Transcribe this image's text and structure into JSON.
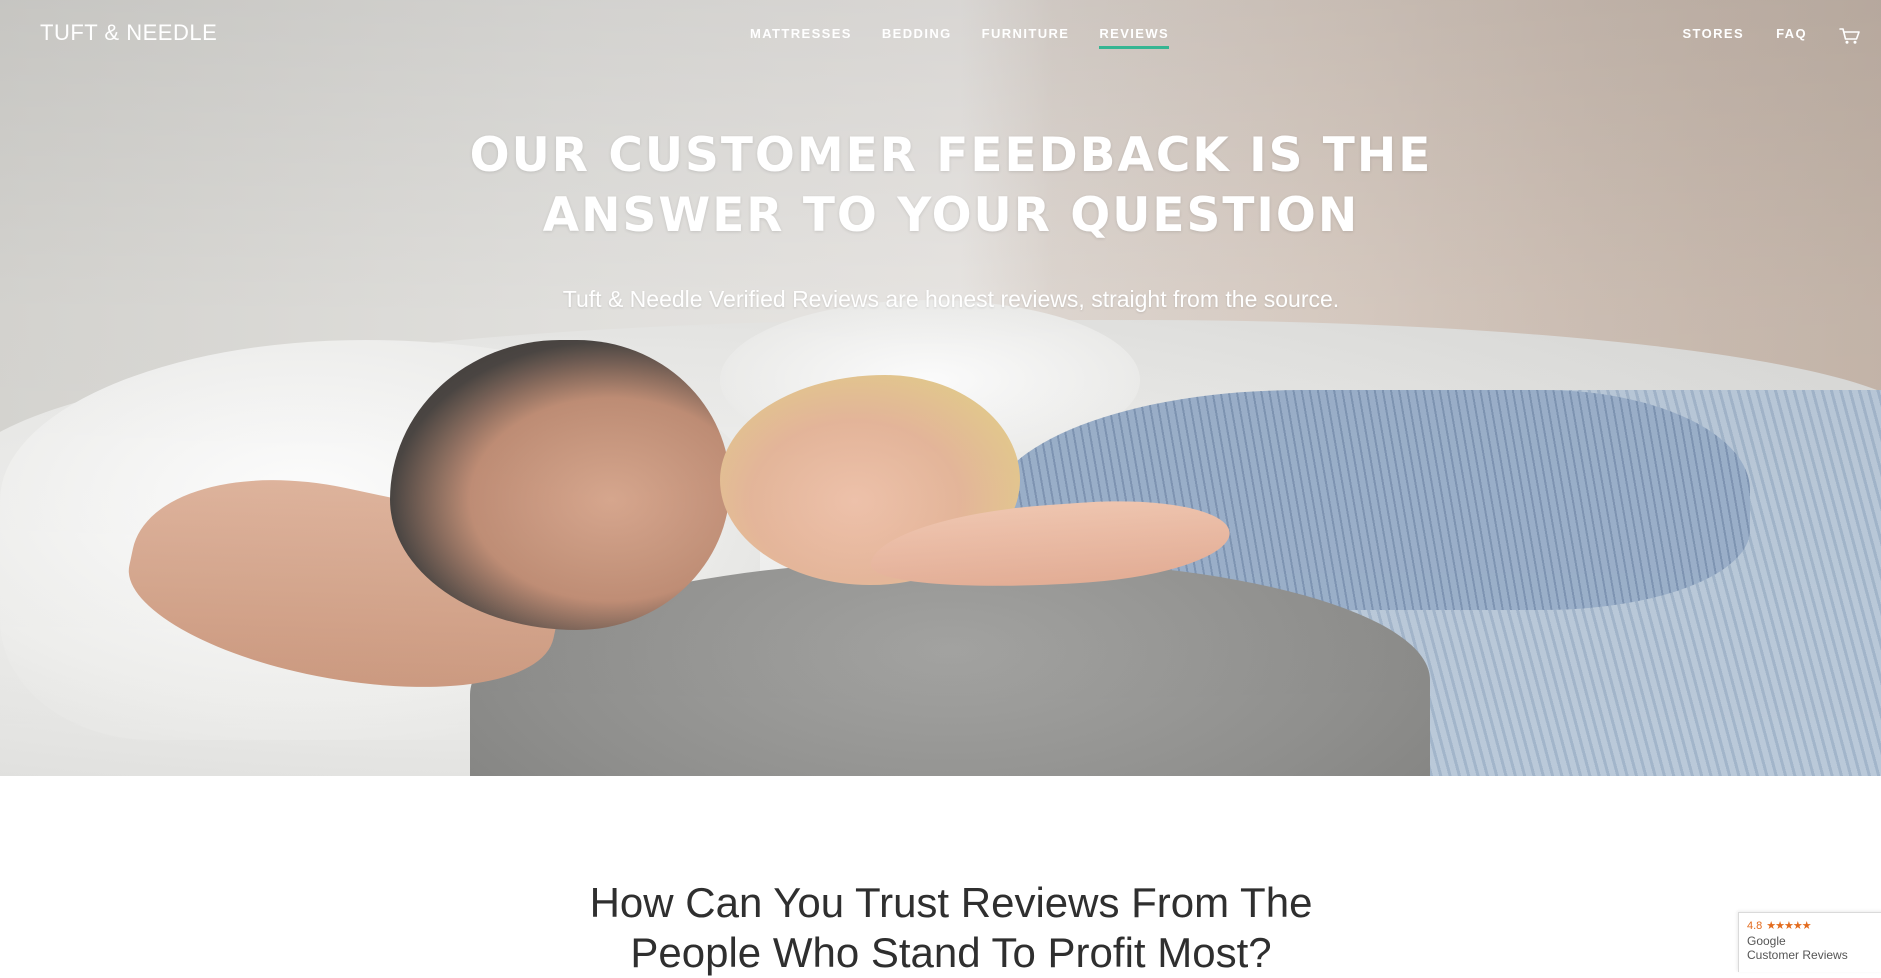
{
  "brand": {
    "logo_text": "TUFT & NEEDLE"
  },
  "nav": {
    "links": [
      {
        "label": "MATTRESSES"
      },
      {
        "label": "BEDDING"
      },
      {
        "label": "FURNITURE"
      },
      {
        "label": "REVIEWS",
        "active": true
      }
    ],
    "right_links": [
      {
        "label": "STORES"
      },
      {
        "label": "FAQ"
      }
    ],
    "cart_icon": "cart-icon",
    "active_color": "#35b592"
  },
  "hero": {
    "title_line1": "OUR CUSTOMER FEEDBACK IS THE",
    "title_line2": "ANSWER TO YOUR QUESTION",
    "subtitle": "Tuft & Needle Verified Reviews are honest reviews, straight from the source."
  },
  "section": {
    "title_line1": "How Can You Trust Reviews From The",
    "title_line2": "People Who Stand To Profit Most?"
  },
  "google_badge": {
    "rating": "4.8",
    "stars": "★★★★★",
    "line1": "Google",
    "line2": "Customer Reviews",
    "star_color": "#e36b1d"
  }
}
